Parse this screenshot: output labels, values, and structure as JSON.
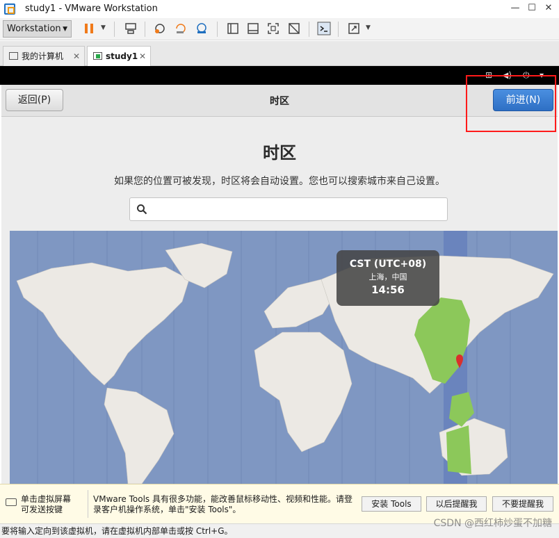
{
  "window": {
    "title": "study1 - VMware Workstation"
  },
  "toolbar": {
    "workstation_menu": "Workstation"
  },
  "tabs": [
    {
      "label": "我的计算机"
    },
    {
      "label": "study1"
    }
  ],
  "installer": {
    "back_button": "返回(P)",
    "header_title": "时区",
    "next_button": "前进(N)",
    "page_title": "时区",
    "description": "如果您的位置可被发现，时区将会自动设置。您也可以搜索城市来自己设置。",
    "search_placeholder": ""
  },
  "map_tooltip": {
    "timezone": "CST (UTC+08)",
    "city": "上海，中国",
    "time": "14:56"
  },
  "hint_bar": {
    "click_text": "单击虚拟屏幕\n可发送按键",
    "tools_text": "VMware Tools 具有很多功能，能改善鼠标移动性、视频和性能。请登录客户机操作系统，单击\"安装 Tools\"。",
    "install_tools": "安装 Tools",
    "remind_later": "以后提醒我",
    "never_remind": "不要提醒我"
  },
  "status_bar": {
    "text": "要将输入定向到该虚拟机，请在虚拟机内部单击或按 Ctrl+G。"
  },
  "watermark": "CSDN @西红柿炒蛋不加糖",
  "colors": {
    "accent": "#2e6fc4",
    "highlight_box": "#ff1a1a",
    "map_ocean": "#7f97c2",
    "land": "#ece9e4",
    "selected_zone": "#8cc85a"
  }
}
